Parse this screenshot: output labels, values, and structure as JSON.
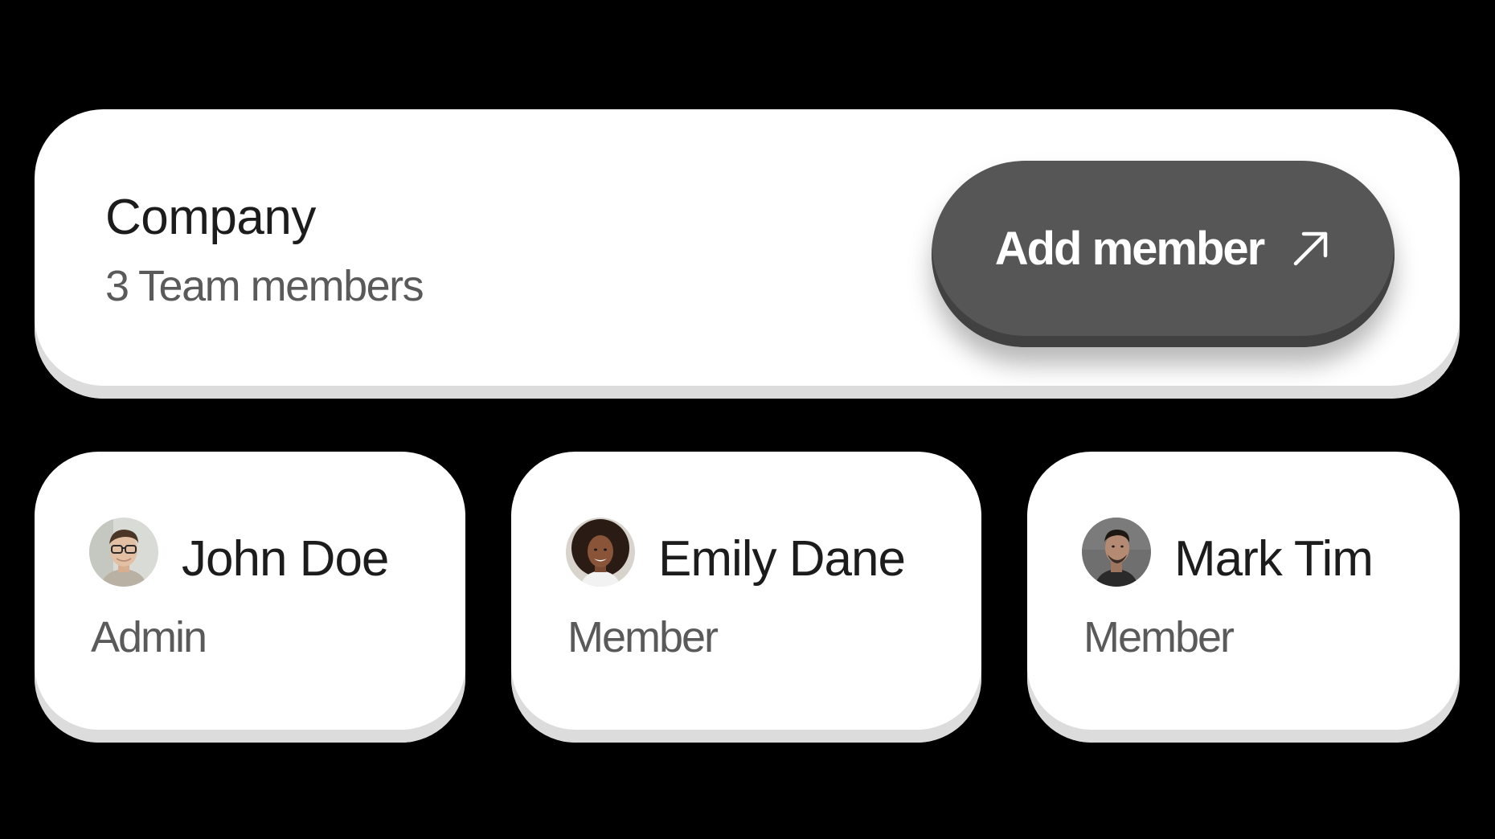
{
  "company": {
    "title": "Company",
    "subtitle": "3 Team members",
    "add_button_label": "Add member",
    "add_button_icon": "arrow-up-right-icon"
  },
  "members": [
    {
      "name": "John Doe",
      "role": "Admin",
      "avatar": "avatar-john-doe"
    },
    {
      "name": "Emily Dane",
      "role": "Member",
      "avatar": "avatar-emily-dane"
    },
    {
      "name": "Mark Tim",
      "role": "Member",
      "avatar": "avatar-mark-tim"
    }
  ],
  "colors": {
    "background": "#000000",
    "card": "#ffffff",
    "button": "#565656",
    "title_text": "#1c1c1c",
    "secondary_text": "#5a5a5a"
  }
}
